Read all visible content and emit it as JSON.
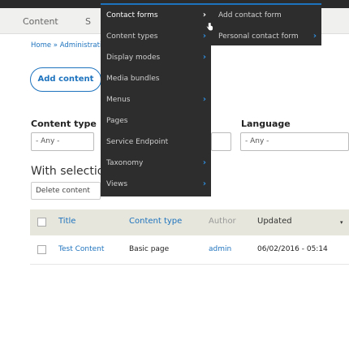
{
  "tabs": [
    {
      "label": "Content"
    },
    {
      "label": "S"
    }
  ],
  "breadcrumb": "Home » Administrati",
  "add_content_label": "Add content",
  "filters": {
    "content_type_label": "Content type",
    "content_type_value": "- Any -",
    "language_label": "Language",
    "language_value": "- Any -"
  },
  "bulk": {
    "heading": "With selection",
    "action_value": "Delete content"
  },
  "table": {
    "headers": {
      "title": "Title",
      "content_type": "Content type",
      "author": "Author",
      "updated": "Updated",
      "sort_glyph": "▾"
    },
    "rows": [
      {
        "title": "Test Content",
        "content_type": "Basic page",
        "author": "admin",
        "updated": "06/02/2016 - 05:14"
      }
    ]
  },
  "menu": {
    "items": [
      {
        "label": "Contact forms",
        "has_children": true
      },
      {
        "label": "Content types",
        "has_children": true
      },
      {
        "label": "Display modes",
        "has_children": true
      },
      {
        "label": "Media bundles",
        "has_children": false
      },
      {
        "label": "Menus",
        "has_children": true
      },
      {
        "label": "Pages",
        "has_children": false
      },
      {
        "label": "Service Endpoint",
        "has_children": false
      },
      {
        "label": "Taxonomy",
        "has_children": true
      },
      {
        "label": "Views",
        "has_children": true
      }
    ],
    "arrow_glyph": "›"
  },
  "submenu": {
    "items": [
      {
        "label": "Add contact form",
        "has_children": false
      },
      {
        "label": "Personal contact form",
        "has_children": true
      }
    ]
  },
  "colors": {
    "accent": "#1e73be",
    "menu_bg": "#2d2d2d",
    "table_header_bg": "#e6e6dc"
  }
}
